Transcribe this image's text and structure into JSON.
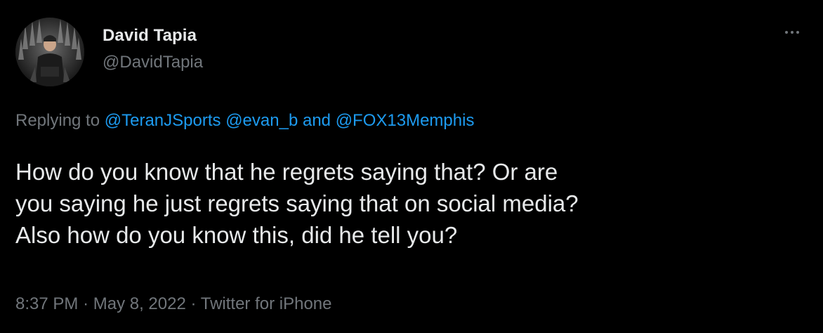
{
  "author": {
    "display_name": "David Tapia",
    "handle": "@DavidTapia"
  },
  "icons": {
    "more": "more-horizontal-icon"
  },
  "reply": {
    "prefix": "Replying to",
    "mentions": [
      "@TeranJSports",
      "@evan_b",
      "@FOX13Memphis"
    ],
    "joiner": "and"
  },
  "tweet": {
    "lines": [
      "How do you know that he regrets saying that? Or are",
      "you saying he just regrets saying that on social media?",
      "Also how do you know this, did he tell you?"
    ]
  },
  "meta": {
    "time": "8:37 PM",
    "separator": "·",
    "date": "May 8, 2022",
    "source": "Twitter for iPhone"
  },
  "colors": {
    "background": "#000000",
    "text": "#e7e9ea",
    "muted": "#71767b",
    "link": "#1d9bf0"
  }
}
